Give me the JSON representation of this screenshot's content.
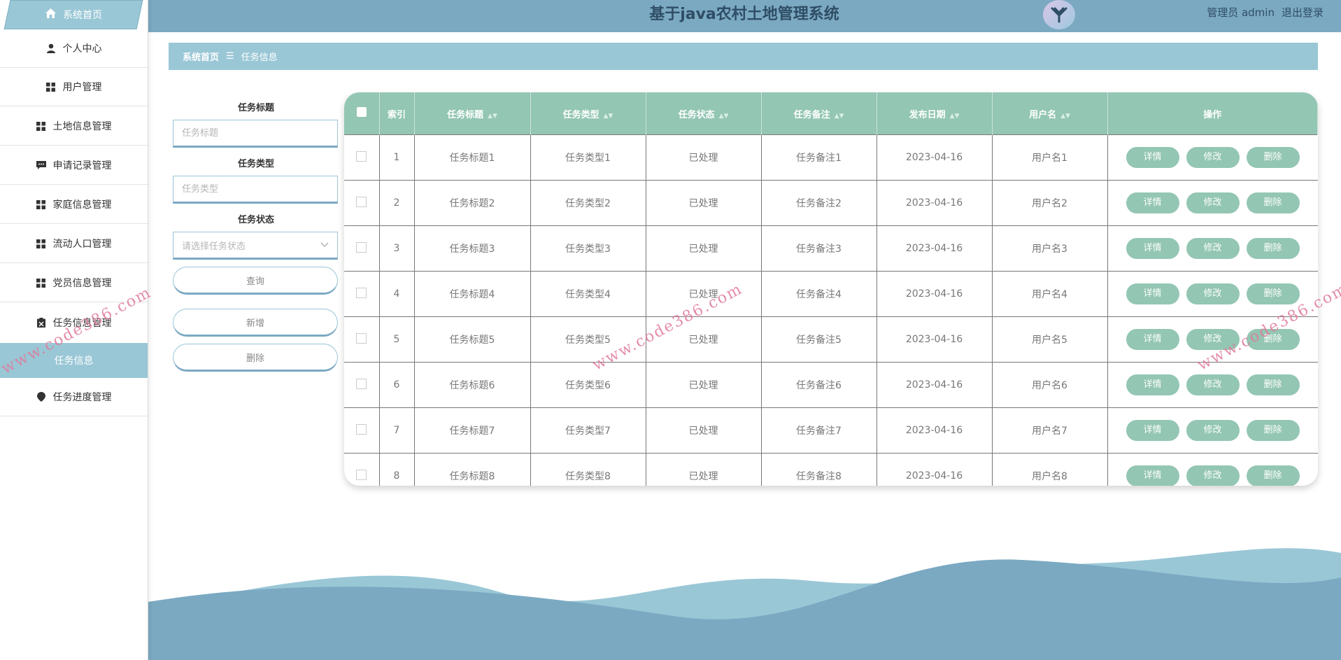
{
  "header": {
    "title": "基于java农村土地管理系统",
    "user_role": "管理员 admin",
    "logout": "退出登录"
  },
  "sidebar": {
    "home": "系统首页",
    "items": [
      {
        "label": "个人中心",
        "icon": "person-icon"
      },
      {
        "label": "用户管理",
        "icon": "grid-icon"
      },
      {
        "label": "土地信息管理",
        "icon": "grid-icon"
      },
      {
        "label": "申请记录管理",
        "icon": "chat-icon"
      },
      {
        "label": "家庭信息管理",
        "icon": "grid-icon"
      },
      {
        "label": "流动人口管理",
        "icon": "grid-icon"
      },
      {
        "label": "党员信息管理",
        "icon": "grid-icon"
      },
      {
        "label": "任务信息管理",
        "icon": "clipboard-icon"
      }
    ],
    "sub_item": "任务信息",
    "last_item": {
      "label": "任务进度管理",
      "icon": "location-icon"
    }
  },
  "breadcrumb": {
    "home": "系统首页",
    "separator": "☰",
    "current": "任务信息"
  },
  "search": {
    "title_label": "任务标题",
    "title_placeholder": "任务标题",
    "type_label": "任务类型",
    "type_placeholder": "任务类型",
    "status_label": "任务状态",
    "status_placeholder": "请选择任务状态",
    "query_button": "查询",
    "add_button": "新增",
    "delete_button": "删除"
  },
  "table": {
    "columns": [
      "索引",
      "任务标题",
      "任务类型",
      "任务状态",
      "任务备注",
      "发布日期",
      "用户名",
      "操作"
    ],
    "rows": [
      {
        "index": "1",
        "title": "任务标题1",
        "type": "任务类型1",
        "status": "已处理",
        "note": "任务备注1",
        "date": "2023-04-16",
        "user": "用户名1"
      },
      {
        "index": "2",
        "title": "任务标题2",
        "type": "任务类型2",
        "status": "已处理",
        "note": "任务备注2",
        "date": "2023-04-16",
        "user": "用户名2"
      },
      {
        "index": "3",
        "title": "任务标题3",
        "type": "任务类型3",
        "status": "已处理",
        "note": "任务备注3",
        "date": "2023-04-16",
        "user": "用户名3"
      },
      {
        "index": "4",
        "title": "任务标题4",
        "type": "任务类型4",
        "status": "已处理",
        "note": "任务备注4",
        "date": "2023-04-16",
        "user": "用户名4"
      },
      {
        "index": "5",
        "title": "任务标题5",
        "type": "任务类型5",
        "status": "已处理",
        "note": "任务备注5",
        "date": "2023-04-16",
        "user": "用户名5"
      },
      {
        "index": "6",
        "title": "任务标题6",
        "type": "任务类型6",
        "status": "已处理",
        "note": "任务备注6",
        "date": "2023-04-16",
        "user": "用户名6"
      },
      {
        "index": "7",
        "title": "任务标题7",
        "type": "任务类型7",
        "status": "已处理",
        "note": "任务备注7",
        "date": "2023-04-16",
        "user": "用户名7"
      },
      {
        "index": "8",
        "title": "任务标题8",
        "type": "任务类型8",
        "status": "已处理",
        "note": "任务备注8",
        "date": "2023-04-16",
        "user": "用户名8"
      }
    ],
    "actions": {
      "detail": "详情",
      "edit": "修改",
      "delete": "删除"
    }
  },
  "watermark": "www.code386.com",
  "colors": {
    "header_bg": "#7ba9c2",
    "accent": "#9ac7d6",
    "table_head": "#93c6b3",
    "title_text": "#2f4e66"
  }
}
